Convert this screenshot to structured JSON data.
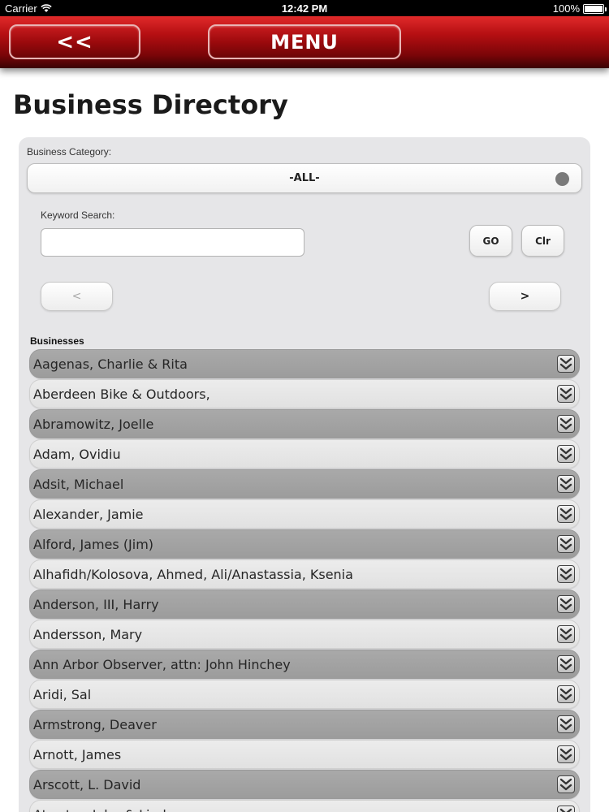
{
  "status_bar": {
    "carrier": "Carrier",
    "time": "12:42 PM",
    "battery": "100%"
  },
  "header": {
    "back_label": "<<",
    "menu_label": "MENU"
  },
  "page_title": "Business Directory",
  "filters": {
    "category_label": "Business Category:",
    "category_value": "-ALL-",
    "keyword_label": "Keyword Search:",
    "keyword_value": "",
    "keyword_placeholder": "",
    "go_label": "GO",
    "clear_label": "Clr",
    "prev_label": "<",
    "next_label": ">"
  },
  "businesses_label": "Businesses",
  "businesses": [
    "Aagenas, Charlie & Rita",
    "Aberdeen Bike & Outdoors,",
    "Abramowitz, Joelle",
    "Adam, Ovidiu",
    "Adsit, Michael",
    "Alexander, Jamie",
    "Alford, James (Jim)",
    "Alhafidh/Kolosova, Ahmed, Ali/Anastassia, Ksenia",
    "Anderson, III, Harry",
    "Andersson, Mary",
    "Ann Arbor Observer, attn: John Hinchey",
    "Aridi, Sal",
    "Armstrong, Deaver",
    "Arnott, James",
    "Arscott, L. David",
    "Atwater, John & Linda"
  ]
}
